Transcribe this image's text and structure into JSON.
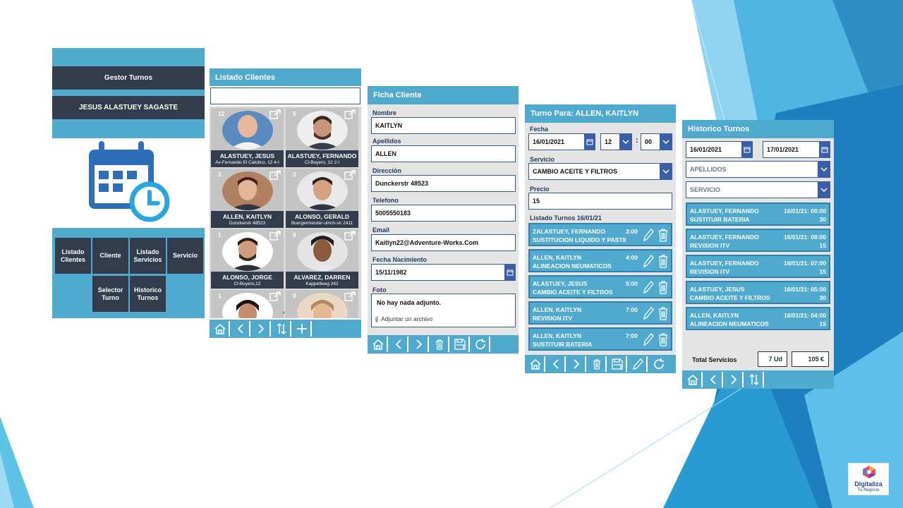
{
  "colors": {
    "accent": "#4faacd",
    "dark": "#323c4c",
    "field_border": "#2f5d8e",
    "dropdown": "#3a5fa8"
  },
  "main_menu": {
    "title": "Gestor Turnos",
    "user": "JESUS ALASTUEY SAGASTE",
    "icon": "calendar-clock-icon",
    "tiles": [
      "Listado Clientes",
      "Cliente",
      "Listado Servicios",
      "Servicio",
      "Selector Turno",
      "Historico Turnos"
    ]
  },
  "listado": {
    "title": "Listado Clientes",
    "search_value": "",
    "cards": [
      {
        "count": "12",
        "name": "ALASTUEY, JESUS",
        "address": "Av-Fernando El Catolico, 12 4-I"
      },
      {
        "count": "5",
        "name": "ALASTUEY, FERNANDO",
        "address": "Cl-Boyero, 12 2-I"
      },
      {
        "count": "3",
        "name": "ALLEN, KAITLYN",
        "address": "Dunckerstr 48523"
      },
      {
        "count": "3",
        "name": "ALONSO, GERALD",
        "address": "Buergermeister-ulrich-str 2411"
      },
      {
        "count": "1",
        "name": "ALONSO, JORGE",
        "address": "Cl-Boyero,12"
      },
      {
        "count": "0",
        "name": "ALVAREZ, DARREN",
        "address": "Kappellweg 242"
      },
      {
        "count": "1",
        "name": "",
        "address": ""
      },
      {
        "count": "0",
        "name": "",
        "address": ""
      }
    ],
    "toolbar": [
      "home-icon",
      "back-icon",
      "forward-icon",
      "sort-icon",
      "add-icon"
    ]
  },
  "ficha": {
    "title": "Ficha Cliente",
    "fields": [
      {
        "label": "Nombre",
        "value": "KAITLYN"
      },
      {
        "label": "Apellidos",
        "value": "ALLEN"
      },
      {
        "label": "Dirección",
        "value": "Dunckerstr 48523"
      },
      {
        "label": "Telefono",
        "value": "5005550183"
      },
      {
        "label": "Email",
        "value": "Kaitlyn22@Adventure-Works.Com"
      },
      {
        "label": "Fecha Nacimiento",
        "value": "15/11/1982"
      }
    ],
    "foto_label": "Foto",
    "foto_empty": "No hay nada adjunto.",
    "foto_attach": "Adjuntar un archivo",
    "toolbar": [
      "home-icon",
      "back-icon",
      "forward-icon",
      "trash-icon",
      "save-icon",
      "refresh-icon"
    ]
  },
  "turno": {
    "title": "Turno Para:  ALLEN, KAITLYN",
    "fecha_label": "Fecha",
    "fecha": "16/01/2021",
    "hour": "12",
    "minute": "00",
    "servicio_label": "Servicio",
    "servicio": "CAMBIO ACEITE Y FILTROS",
    "precio_label": "Precio",
    "precio": "15",
    "list_title": "Listado Turnos  16/01/21",
    "items": [
      {
        "name": "ZALASTUEY, FERNANDO",
        "service": "SUSTITUCION LIQUIDO Y PASTII",
        "time": "3:00"
      },
      {
        "name": "ALLEN, KAITLYN",
        "service": "ALINEACION NEUMATICOS",
        "time": "4:00"
      },
      {
        "name": "ALASTUEY, JESUS",
        "service": "CAMBIO ACEITE Y FILTROS",
        "time": "5:00"
      },
      {
        "name": "ALLEN, KAITLYN",
        "service": "REVISION ITV",
        "time": "7:00"
      },
      {
        "name": "ALLEN, KAITLYN",
        "service": "SUSTITUIR BATERIA",
        "time": "7:00"
      }
    ],
    "toolbar": [
      "home-icon",
      "back-icon",
      "forward-icon",
      "trash-icon",
      "save-icon",
      "edit-icon",
      "refresh-icon"
    ]
  },
  "historico": {
    "title": "Historico Turnos",
    "date_from": "16/01/2021",
    "date_to": "17/01/2021",
    "apellidos_placeholder": "APELLIDOS",
    "servicio_placeholder": "SERVICIO",
    "items": [
      {
        "name": "ALASTUEY, FERNANDO",
        "service": "SUSTITUIR BATERIA",
        "datetime": "16/01/21: 09:00",
        "price": "30"
      },
      {
        "name": "ALASTUEY, FERNANDO",
        "service": "REVISION ITV",
        "datetime": "16/01/21: 08:00",
        "price": "15"
      },
      {
        "name": "ALASTUEY, FERNANDO",
        "service": "REVISION ITV",
        "datetime": "16/01/21: 07:00",
        "price": "15"
      },
      {
        "name": "ALASTUEY, JESUS",
        "service": "CAMBIO ACEITE Y FILTROS",
        "datetime": "16/01/21: 05:00",
        "price": "30"
      },
      {
        "name": "ALLEN, KAITLYN",
        "service": "ALINEACION NEUMATICOS",
        "datetime": "16/01/21: 04:00",
        "price": "15"
      }
    ],
    "total_label": "Total Servicios",
    "total_units": "7 Ud",
    "total_amount": "105 €",
    "toolbar": [
      "home-icon",
      "back-icon",
      "forward-icon",
      "sort-icon"
    ]
  },
  "logo": {
    "line1": "Digitaliza",
    "line2": "Tu Negocio"
  }
}
